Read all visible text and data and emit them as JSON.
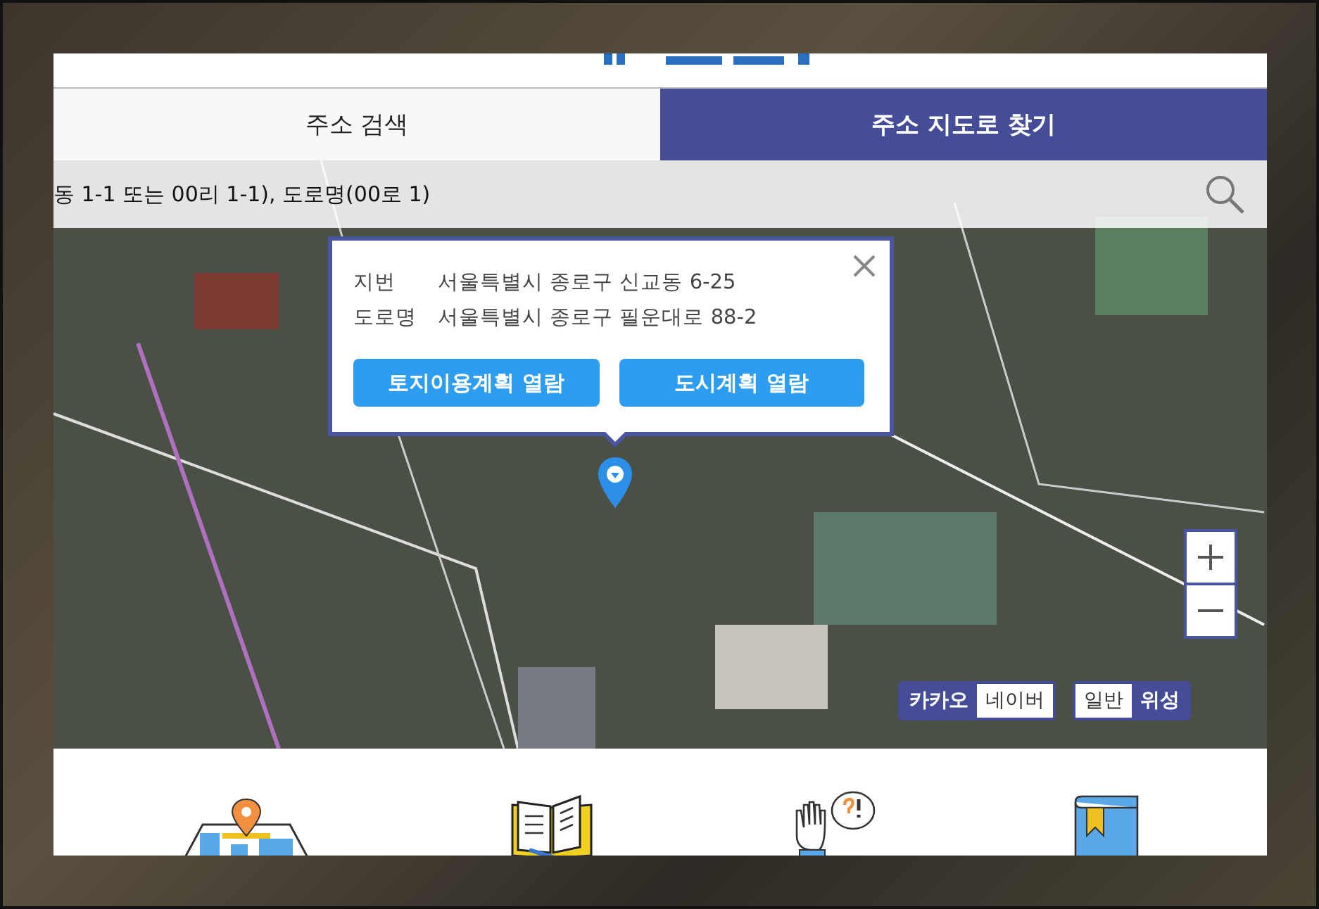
{
  "tabs": [
    {
      "label": "주소 검색",
      "selected": false
    },
    {
      "label": "주소 지도로 찾기",
      "selected": true
    }
  ],
  "search": {
    "placeholder": "동 1-1 또는 00리 1-1), 도로명(00로 1)"
  },
  "popup": {
    "rows": [
      {
        "label": "지번",
        "value": "서울특별시 종로구 신교동 6-25"
      },
      {
        "label": "도로명",
        "value": "서울특별시 종로구 필운대로 88-2"
      }
    ],
    "buttons": [
      "토지이용계획 열람",
      "도시계획 열람"
    ]
  },
  "map_providers": [
    {
      "label": "카카오",
      "selected": true
    },
    {
      "label": "네이버",
      "selected": false
    }
  ],
  "map_types": [
    {
      "label": "일반",
      "selected": false
    },
    {
      "label": "위성",
      "selected": true
    }
  ]
}
